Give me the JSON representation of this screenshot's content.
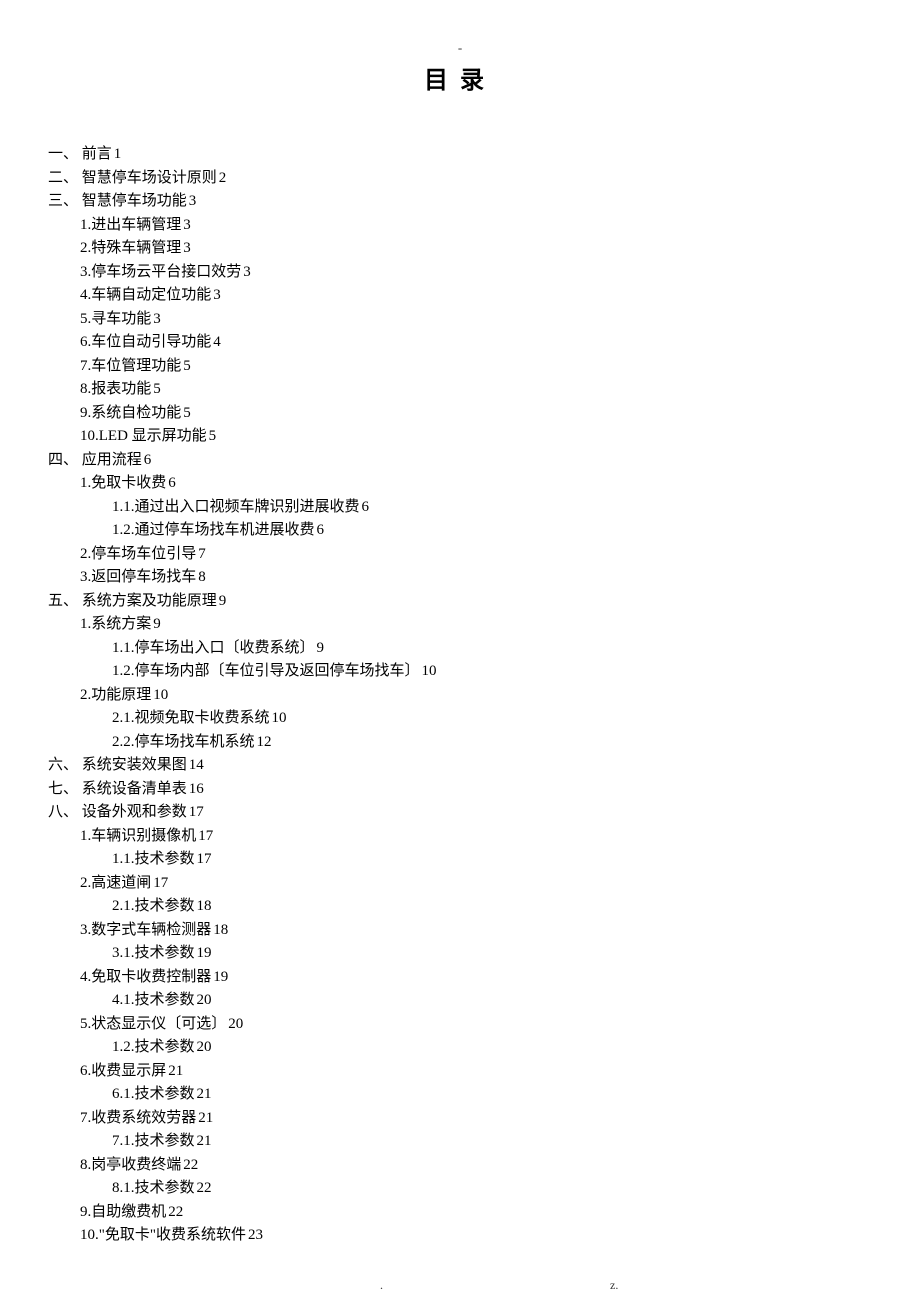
{
  "header_mark": "-",
  "title": "目录",
  "toc": [
    {
      "indent": 0,
      "text": "一、 前言",
      "page": "1"
    },
    {
      "indent": 0,
      "text": "二、 智慧停车场设计原则",
      "page": "2"
    },
    {
      "indent": 0,
      "text": "三、 智慧停车场功能",
      "page": "3"
    },
    {
      "indent": 1,
      "text": "1.进出车辆管理",
      "page": "3"
    },
    {
      "indent": 1,
      "text": "2.特殊车辆管理",
      "page": "3"
    },
    {
      "indent": 1,
      "text": "3.停车场云平台接口效劳",
      "page": "3"
    },
    {
      "indent": 1,
      "text": "4.车辆自动定位功能",
      "page": "3"
    },
    {
      "indent": 1,
      "text": "5.寻车功能",
      "page": "3"
    },
    {
      "indent": 1,
      "text": "6.车位自动引导功能",
      "page": "4"
    },
    {
      "indent": 1,
      "text": "7.车位管理功能",
      "page": "5"
    },
    {
      "indent": 1,
      "text": "8.报表功能",
      "page": "5"
    },
    {
      "indent": 1,
      "text": "9.系统自检功能",
      "page": "5"
    },
    {
      "indent": 1,
      "text": "10.LED 显示屏功能",
      "page": "5"
    },
    {
      "indent": 0,
      "text": "四、 应用流程",
      "page": "6"
    },
    {
      "indent": 1,
      "text": "1.免取卡收费",
      "page": "6"
    },
    {
      "indent": 2,
      "text": "1.1.通过出入口视频车牌识别进展收费",
      "page": "6"
    },
    {
      "indent": 2,
      "text": "1.2.通过停车场找车机进展收费",
      "page": "6"
    },
    {
      "indent": 1,
      "text": "2.停车场车位引导",
      "page": "7"
    },
    {
      "indent": 1,
      "text": "3.返回停车场找车",
      "page": "8"
    },
    {
      "indent": 0,
      "text": "五、 系统方案及功能原理",
      "page": "9"
    },
    {
      "indent": 1,
      "text": "1.系统方案",
      "page": "9"
    },
    {
      "indent": 2,
      "text": "1.1.停车场出入口〔收费系统〕",
      "page": "9"
    },
    {
      "indent": 2,
      "text": "1.2.停车场内部〔车位引导及返回停车场找车〕",
      "page": "10"
    },
    {
      "indent": 1,
      "text": "2.功能原理",
      "page": "10"
    },
    {
      "indent": 2,
      "text": "2.1.视频免取卡收费系统",
      "page": "10"
    },
    {
      "indent": 2,
      "text": "2.2.停车场找车机系统",
      "page": "12"
    },
    {
      "indent": 0,
      "text": "六、 系统安装效果图",
      "page": "14"
    },
    {
      "indent": 0,
      "text": "七、 系统设备清单表",
      "page": "16"
    },
    {
      "indent": 0,
      "text": "八、 设备外观和参数",
      "page": "17"
    },
    {
      "indent": 1,
      "text": "1.车辆识别摄像机",
      "page": "17"
    },
    {
      "indent": 2,
      "text": "1.1.技术参数",
      "page": "17"
    },
    {
      "indent": 1,
      "text": "2.高速道闸",
      "page": "17"
    },
    {
      "indent": 2,
      "text": "2.1.技术参数",
      "page": "18"
    },
    {
      "indent": 1,
      "text": "3.数字式车辆检测器",
      "page": "18"
    },
    {
      "indent": 2,
      "text": "3.1.技术参数",
      "page": "19"
    },
    {
      "indent": 1,
      "text": "4.免取卡收费控制器",
      "page": "19"
    },
    {
      "indent": 2,
      "text": "4.1.技术参数",
      "page": "20"
    },
    {
      "indent": 1,
      "text": "5.状态显示仪〔可选〕",
      "page": "20"
    },
    {
      "indent": 2,
      "text": "1.2.技术参数",
      "page": "20"
    },
    {
      "indent": 1,
      "text": "6.收费显示屏",
      "page": "21"
    },
    {
      "indent": 2,
      "text": "6.1.技术参数",
      "page": "21"
    },
    {
      "indent": 1,
      "text": "7.收费系统效劳器",
      "page": "21"
    },
    {
      "indent": 2,
      "text": "7.1.技术参数",
      "page": "21"
    },
    {
      "indent": 1,
      "text": "8.岗亭收费终端",
      "page": "22"
    },
    {
      "indent": 2,
      "text": "8.1.技术参数",
      "page": "22"
    },
    {
      "indent": 1,
      "text": "9.自助缴费机",
      "page": "22"
    },
    {
      "indent": 1,
      "text": "10.\"免取卡\"收费系统软件",
      "page": "23"
    }
  ],
  "footer": {
    "dot": ".",
    "z": "z."
  }
}
